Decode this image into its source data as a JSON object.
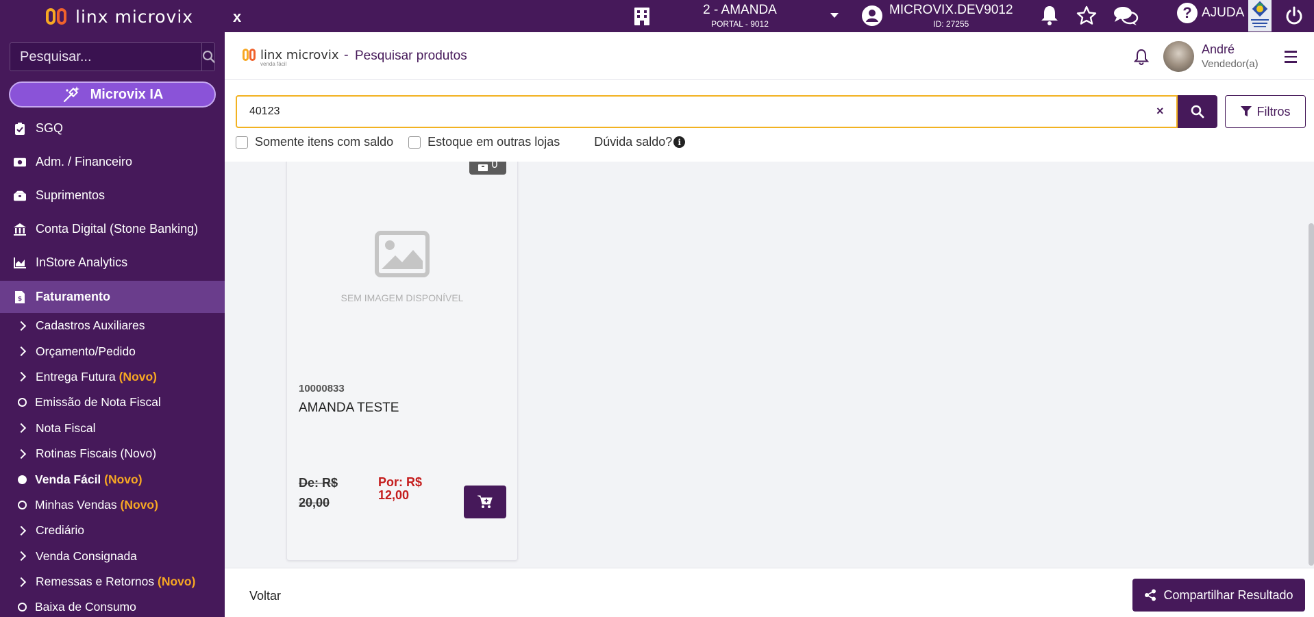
{
  "sidebar": {
    "logo_text": "linx microvix",
    "search_placeholder": "Pesquisar...",
    "ia_label": "Microvix IA",
    "items": [
      {
        "label": "SGQ",
        "icon": "clipboard-check-icon"
      },
      {
        "label": "Adm. / Financeiro",
        "icon": "money-bill-icon"
      },
      {
        "label": "Suprimentos",
        "icon": "boxes-icon"
      },
      {
        "label": "Conta Digital (Stone Banking)",
        "icon": "bank-icon"
      },
      {
        "label": "InStore Analytics",
        "icon": "chart-area-icon"
      },
      {
        "label": "Faturamento",
        "icon": "invoice-icon"
      }
    ],
    "subitems": [
      {
        "label": "Cadastros Auxiliares",
        "novo": "",
        "marker": "chevron"
      },
      {
        "label": "Orçamento/Pedido",
        "novo": "",
        "marker": "chevron"
      },
      {
        "label": "Entrega Futura ",
        "novo": "(Novo)",
        "marker": "chevron"
      },
      {
        "label": "Emissão de Nota Fiscal",
        "novo": "",
        "marker": "circle"
      },
      {
        "label": "Nota Fiscal",
        "novo": "",
        "marker": "chevron"
      },
      {
        "label": "Rotinas Fiscais (Novo)",
        "novo": "",
        "marker": "chevron"
      },
      {
        "label": "Venda Fácil ",
        "novo": "(Novo)",
        "marker": "dot"
      },
      {
        "label": "Minhas Vendas ",
        "novo": "(Novo)",
        "marker": "circle"
      },
      {
        "label": "Crediário",
        "novo": "",
        "marker": "chevron"
      },
      {
        "label": "Venda Consignada",
        "novo": "",
        "marker": "chevron"
      },
      {
        "label": "Remessas e Retornos ",
        "novo": "(Novo)",
        "marker": "chevron"
      },
      {
        "label": "Baixa de Consumo",
        "novo": "",
        "marker": "circle"
      }
    ]
  },
  "topbar": {
    "close_label": "x",
    "store_name": "2 - AMANDA",
    "store_sub": "PORTAL - 9012",
    "user_name": "MICROVIX.DEV9012",
    "user_id": "ID: 27255",
    "help_label": "AJUDA"
  },
  "header": {
    "logo_text": "linx microvix",
    "logo_sub": "venda fácil",
    "separator": "-",
    "title": "Pesquisar produtos",
    "user_name": "André",
    "user_role": "Vendedor(a)"
  },
  "search": {
    "value": "40123",
    "clear_label": "×",
    "filters_label": "Filtros",
    "option_saldo": "Somente itens com saldo",
    "option_outras": "Estoque em outras lojas",
    "duvida_label": "Dúvida saldo?",
    "info_glyph": "i"
  },
  "product": {
    "stock_count": "0",
    "no_image_text": "SEM IMAGEM DISPONÍVEL",
    "code": "10000833",
    "name": "AMANDA TESTE",
    "old_price": "De: R$ 20,00",
    "new_price": "Por: R$ 12,00"
  },
  "footer": {
    "back_label": "Voltar",
    "share_label": "Compartilhar Resultado"
  },
  "colors": {
    "brand": "#46195a",
    "accent_ia": "#8a53d8",
    "novo": "#f7a823",
    "price_red": "#c41c1c",
    "search_border": "#f2b221"
  }
}
